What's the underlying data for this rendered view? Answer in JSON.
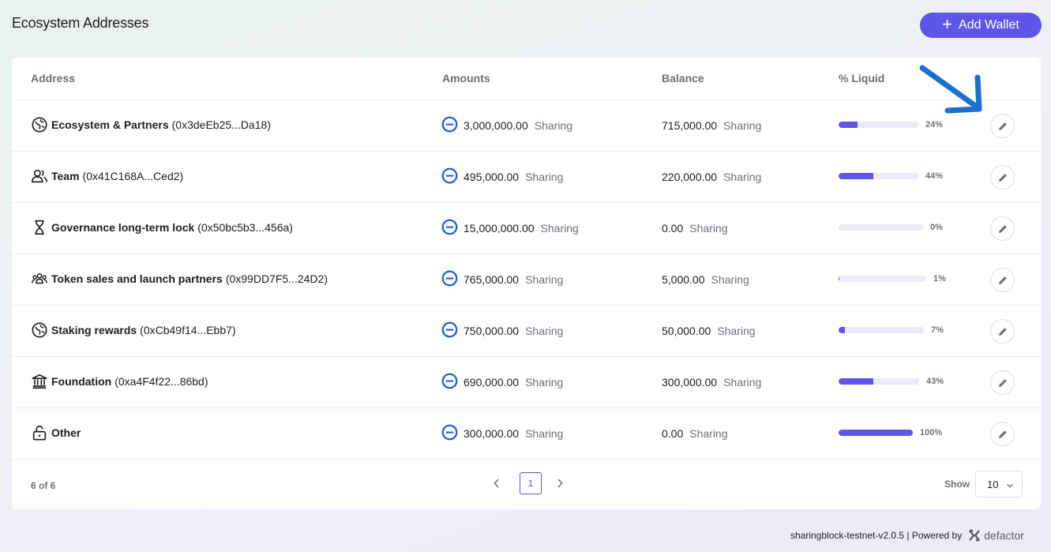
{
  "header": {
    "title": "Ecosystem Addresses",
    "add_button": "Add Wallet"
  },
  "table": {
    "columns": [
      "Address",
      "Amounts",
      "Balance",
      "% Liquid"
    ],
    "rows": [
      {
        "icon": "globe-icon",
        "name": "Ecosystem & Partners",
        "address": "(0x3deEb25...Da18)",
        "amount": "3,000,000.00",
        "amount_unit": "Sharing",
        "balance": "715,000.00",
        "balance_unit": "Sharing",
        "liquid_pct": 24,
        "liquid_label": "24%"
      },
      {
        "icon": "users-icon",
        "name": "Team",
        "address": "(0x41C168A...Ced2)",
        "amount": "495,000.00",
        "amount_unit": "Sharing",
        "balance": "220,000.00",
        "balance_unit": "Sharing",
        "liquid_pct": 44,
        "liquid_label": "44%"
      },
      {
        "icon": "hourglass-icon",
        "name": "Governance long-term lock",
        "address": "(0x50bc5b3...456a)",
        "amount": "15,000,000.00",
        "amount_unit": "Sharing",
        "balance": "0.00",
        "balance_unit": "Sharing",
        "liquid_pct": 0,
        "liquid_label": "0%"
      },
      {
        "icon": "group-icon",
        "name": "Token sales and launch partners",
        "address": "(0x99DD7F5...24D2)",
        "amount": "765,000.00",
        "amount_unit": "Sharing",
        "balance": "5,000.00",
        "balance_unit": "Sharing",
        "liquid_pct": 1,
        "liquid_label": "1%"
      },
      {
        "icon": "globe-icon",
        "name": "Staking rewards",
        "address": "(0xCb49f14...Ebb7)",
        "amount": "750,000.00",
        "amount_unit": "Sharing",
        "balance": "50,000.00",
        "balance_unit": "Sharing",
        "liquid_pct": 7,
        "liquid_label": "7%"
      },
      {
        "icon": "bank-icon",
        "name": "Foundation",
        "address": "(0xa4F4f22...86bd)",
        "amount": "690,000.00",
        "amount_unit": "Sharing",
        "balance": "300,000.00",
        "balance_unit": "Sharing",
        "liquid_pct": 43,
        "liquid_label": "43%"
      },
      {
        "icon": "unlock-icon",
        "name": "Other",
        "address": "",
        "amount": "300,000.00",
        "amount_unit": "Sharing",
        "balance": "0.00",
        "balance_unit": "Sharing",
        "liquid_pct": 100,
        "liquid_label": "100%"
      }
    ]
  },
  "footer": {
    "count": "6 of 6",
    "page": "1",
    "show_label": "Show",
    "show_value": "10"
  },
  "powered": {
    "version": "sharingblock-testnet-v2.0.5 | Powered by",
    "brand": "defactor"
  },
  "colors": {
    "accent": "#5f55e8",
    "coin": "#1f5fe0",
    "annotation_arrow": "#1a6fd0"
  }
}
